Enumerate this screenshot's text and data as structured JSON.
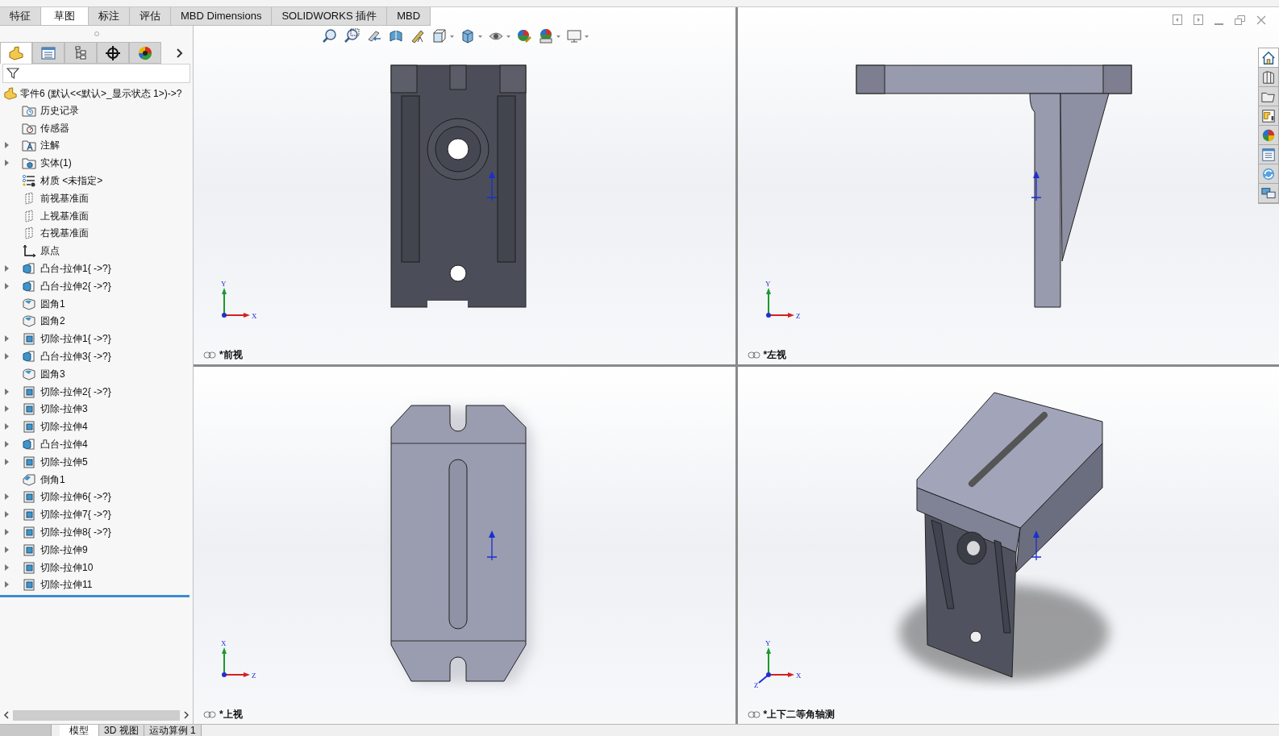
{
  "command_tabs": [
    {
      "label": "特征",
      "selected": false
    },
    {
      "label": "草图",
      "selected": true
    },
    {
      "label": "标注",
      "selected": false
    },
    {
      "label": "评估",
      "selected": false
    },
    {
      "label": "MBD Dimensions",
      "selected": false
    },
    {
      "label": "SOLIDWORKS 插件",
      "selected": false
    },
    {
      "label": "MBD",
      "selected": false
    }
  ],
  "panel_tabs": [
    {
      "kind": "feature",
      "selected": true
    },
    {
      "kind": "property",
      "selected": false
    },
    {
      "kind": "config",
      "selected": false
    },
    {
      "kind": "target",
      "selected": false
    },
    {
      "kind": "display",
      "selected": false
    }
  ],
  "tree": {
    "root": "零件6  (默认<<默认>_显示状态 1>)->?",
    "items": [
      {
        "label": "历史记录",
        "kind": "history",
        "collapsible": false
      },
      {
        "label": "传感器",
        "kind": "sensor",
        "collapsible": false
      },
      {
        "label": "注解",
        "kind": "annotation",
        "collapsible": true
      },
      {
        "label": "实体(1)",
        "kind": "solid",
        "collapsible": true
      },
      {
        "label": "材质 <未指定>",
        "kind": "material",
        "collapsible": false
      },
      {
        "label": "前视基准面",
        "kind": "plane",
        "collapsible": false
      },
      {
        "label": "上视基准面",
        "kind": "plane",
        "collapsible": false
      },
      {
        "label": "右视基准面",
        "kind": "plane",
        "collapsible": false
      },
      {
        "label": "原点",
        "kind": "origin",
        "collapsible": false
      },
      {
        "label": "凸台-拉伸1{ ->?}",
        "kind": "boss",
        "collapsible": true
      },
      {
        "label": "凸台-拉伸2{ ->?}",
        "kind": "boss",
        "collapsible": true
      },
      {
        "label": "圆角1",
        "kind": "fillet",
        "collapsible": false
      },
      {
        "label": "圆角2",
        "kind": "fillet",
        "collapsible": false
      },
      {
        "label": "切除-拉伸1{ ->?}",
        "kind": "cut",
        "collapsible": true
      },
      {
        "label": "凸台-拉伸3{ ->?}",
        "kind": "boss",
        "collapsible": true
      },
      {
        "label": "圆角3",
        "kind": "fillet",
        "collapsible": false
      },
      {
        "label": "切除-拉伸2{ ->?}",
        "kind": "cut",
        "collapsible": true
      },
      {
        "label": "切除-拉伸3",
        "kind": "cut",
        "collapsible": true
      },
      {
        "label": "切除-拉伸4",
        "kind": "cut",
        "collapsible": true
      },
      {
        "label": "凸台-拉伸4",
        "kind": "boss",
        "collapsible": true
      },
      {
        "label": "切除-拉伸5",
        "kind": "cut",
        "collapsible": true
      },
      {
        "label": "倒角1",
        "kind": "chamfer",
        "collapsible": false
      },
      {
        "label": "切除-拉伸6{ ->?}",
        "kind": "cut",
        "collapsible": true
      },
      {
        "label": "切除-拉伸7{ ->?}",
        "kind": "cut",
        "collapsible": true
      },
      {
        "label": "切除-拉伸8{ ->?}",
        "kind": "cut",
        "collapsible": true
      },
      {
        "label": "切除-拉伸9",
        "kind": "cut",
        "collapsible": true
      },
      {
        "label": "切除-拉伸10",
        "kind": "cut",
        "collapsible": true
      },
      {
        "label": "切除-拉伸11",
        "kind": "cut",
        "collapsible": true
      }
    ]
  },
  "viewports": [
    {
      "label": "*前视",
      "kind": "front",
      "triad": [
        "Y",
        "X"
      ]
    },
    {
      "label": "*左视",
      "kind": "left",
      "triad": [
        "Y",
        "Z"
      ]
    },
    {
      "label": "*上视",
      "kind": "top",
      "triad": [
        "X",
        "Z"
      ]
    },
    {
      "label": "*上下二等角轴测",
      "kind": "iso",
      "triad": [
        "Y",
        "X",
        "Z"
      ]
    }
  ],
  "bottom_tabs": [
    {
      "label": "模型",
      "selected": true
    },
    {
      "label": "3D 视图",
      "selected": false
    },
    {
      "label": "运动算例 1",
      "selected": false
    }
  ]
}
